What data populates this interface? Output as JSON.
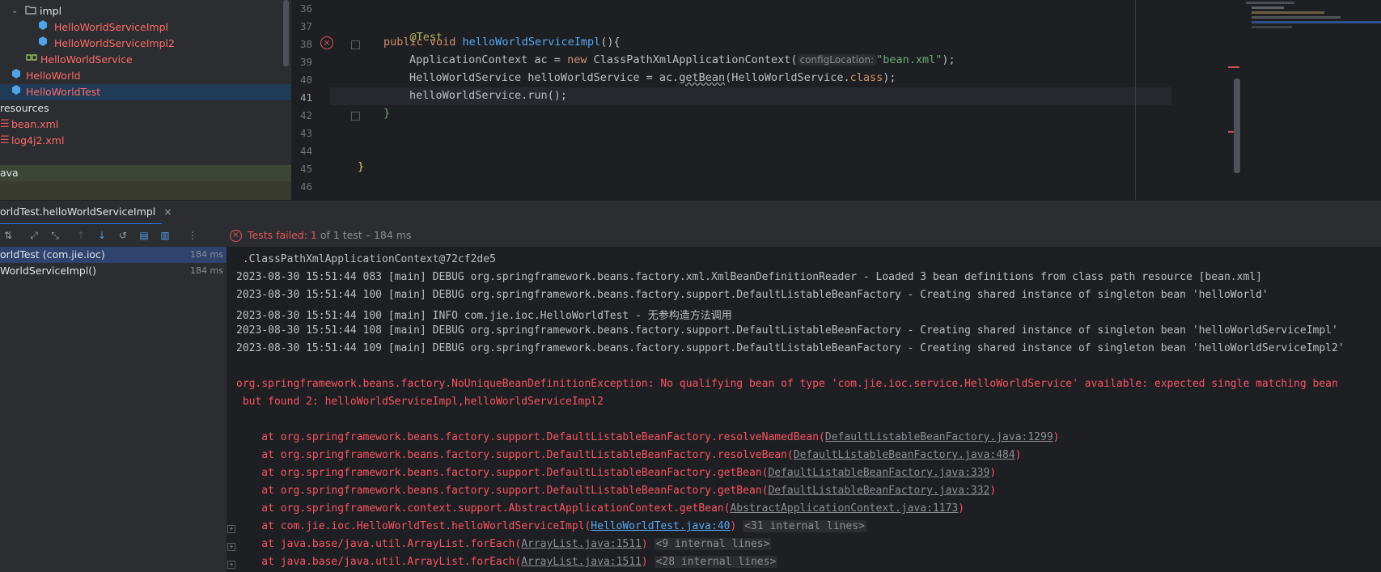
{
  "project_tree": {
    "items": [
      {
        "label": "impl"
      },
      {
        "label": "HelloWorldServiceImpl"
      },
      {
        "label": "HelloWorldServiceImpl2"
      },
      {
        "label": "HelloWorldService"
      },
      {
        "label": "HelloWorld"
      },
      {
        "label": "HelloWorldTest"
      },
      {
        "label": "resources"
      },
      {
        "label": "bean.xml"
      },
      {
        "label": "log4j2.xml"
      },
      {
        "label": "ava"
      }
    ]
  },
  "editor": {
    "line_numbers": [
      "36",
      "37",
      "38",
      "39",
      "40",
      "41",
      "42",
      "43",
      "44",
      "45",
      "46"
    ],
    "lines": {
      "l37_annotation": "@Test",
      "l38_kw": "public void ",
      "l38_fn": "helloWorldServiceImpl",
      "l38_rest": "(){",
      "l39_a": "ApplicationContext ac = ",
      "l39_kw": "new ",
      "l39_b": "ClassPathXmlApplicationContext(",
      "l39_hint": "configLocation:",
      "l39_str": "\"bean.xml\"",
      "l39_end": ");",
      "l40_a": "HelloWorldService helloWorldService = ac.",
      "l40_method": "getBean",
      "l40_b": "(HelloWorldService.",
      "l40_kw": "class",
      "l40_end": ");",
      "l41": "helloWorldService.run();",
      "l42": "}",
      "l45": "}"
    }
  },
  "run_panel": {
    "tab_label": "orldTest.helloWorldServiceImpl",
    "close_glyph": "×",
    "status_prefix": "Tests failed: ",
    "status_count": "1",
    "status_suffix": " of 1 test – 184 ms",
    "tests": [
      {
        "label": "orldTest (com.jie.ioc)",
        "time": "184 ms"
      },
      {
        "label": "WorldServiceImpl()",
        "time": "184 ms"
      }
    ]
  },
  "console": {
    "lines": [
      " .ClassPathXmlApplicationContext@72cf2de5",
      "2023-08-30 15:51:44 083 [main] DEBUG org.springframework.beans.factory.xml.XmlBeanDefinitionReader - Loaded 3 bean definitions from class path resource [bean.xml]",
      "2023-08-30 15:51:44 100 [main] DEBUG org.springframework.beans.factory.support.DefaultListableBeanFactory - Creating shared instance of singleton bean 'helloWorld'",
      "2023-08-30 15:51:44 100 [main] INFO com.jie.ioc.HelloWorldTest - 无参构造方法调用",
      "2023-08-30 15:51:44 108 [main] DEBUG org.springframework.beans.factory.support.DefaultListableBeanFactory - Creating shared instance of singleton bean 'helloWorldServiceImpl'",
      "2023-08-30 15:51:44 109 [main] DEBUG org.springframework.beans.factory.support.DefaultListableBeanFactory - Creating shared instance of singleton bean 'helloWorldServiceImpl2'"
    ],
    "exception_line1": "org.springframework.beans.factory.NoUniqueBeanDefinitionException: No qualifying bean of type 'com.jie.ioc.service.HelloWorldService' available: expected single matching bean",
    "exception_line2": " but found 2: helloWorldServiceImpl,helloWorldServiceImpl2",
    "stack": [
      {
        "text": "    at org.springframework.beans.factory.support.DefaultListableBeanFactory.resolveNamedBean(",
        "link": "DefaultListableBeanFactory.java:1299",
        "end": ")",
        "extra": ""
      },
      {
        "text": "    at org.springframework.beans.factory.support.DefaultListableBeanFactory.resolveBean(",
        "link": "DefaultListableBeanFactory.java:484",
        "end": ")",
        "extra": ""
      },
      {
        "text": "    at org.springframework.beans.factory.support.DefaultListableBeanFactory.getBean(",
        "link": "DefaultListableBeanFactory.java:339",
        "end": ")",
        "extra": ""
      },
      {
        "text": "    at org.springframework.beans.factory.support.DefaultListableBeanFactory.getBean(",
        "link": "DefaultListableBeanFactory.java:332",
        "end": ")",
        "extra": ""
      },
      {
        "text": "    at org.springframework.context.support.AbstractApplicationContext.getBean(",
        "link": "AbstractApplicationContext.java:1173",
        "end": ")",
        "extra": ""
      },
      {
        "text": "    at com.jie.ioc.HelloWorldTest.helloWorldServiceImpl(",
        "link": "HelloWorldTest.java:40",
        "end": ")",
        "extra": "<31 internal lines>"
      },
      {
        "text": "    at java.base/java.util.ArrayList.forEach(",
        "link": "ArrayList.java:1511",
        "end": ")",
        "extra": "<9 internal lines>"
      },
      {
        "text": "    at java.base/java.util.ArrayList.forEach(",
        "link": "ArrayList.java:1511",
        "end": ")",
        "extra": "<28 internal lines>"
      }
    ],
    "expand_glyph": "+"
  },
  "colors": {
    "accent": "#3574f0",
    "error": "#f75464",
    "selection": "#2e436e"
  }
}
